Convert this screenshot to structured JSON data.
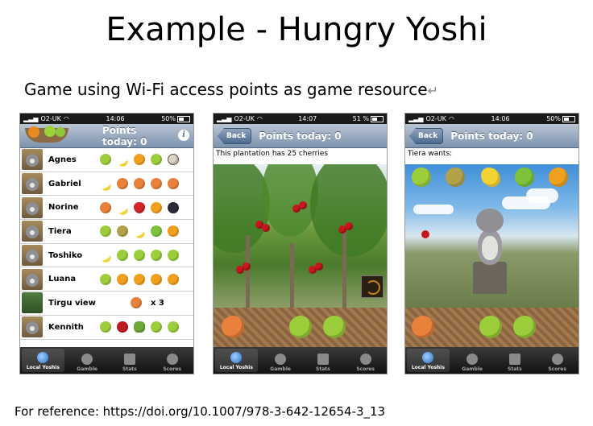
{
  "slide": {
    "title": "Example - Hungry Yoshi",
    "subtitle": "Game using Wi-Fi access points as game resource",
    "reference": "For reference: https://doi.org/10.1007/978-3-642-12654-3_13"
  },
  "screens": [
    {
      "status": {
        "carrier": "O2-UK",
        "time": "14:06",
        "battery": "50%"
      },
      "nav_title": "Points today: 0",
      "info_glyph": "i",
      "rows": [
        {
          "name": "Agnes",
          "fruits": [
            "lime",
            "banana",
            "orange",
            "lime",
            "coconut"
          ]
        },
        {
          "name": "Gabriel",
          "fruits": [
            "banana",
            "peach",
            "peach",
            "peach",
            "peach"
          ]
        },
        {
          "name": "Norine",
          "fruits": [
            "peach",
            "banana",
            "strawberry",
            "orange",
            "blackberry"
          ]
        },
        {
          "name": "Tiera",
          "fruits": [
            "lime",
            "kiwi",
            "banana",
            "apple",
            "orange"
          ]
        },
        {
          "name": "Toshiko",
          "fruits": [
            "banana",
            "lime",
            "lime",
            "lime",
            "lime"
          ]
        },
        {
          "name": "Luana",
          "fruits": [
            "lime",
            "orange",
            "orange",
            "orange",
            "orange"
          ]
        },
        {
          "name": "Tirgu view",
          "count": "x 3",
          "fruits": [
            "peach"
          ]
        },
        {
          "name": "Kennith",
          "fruits": [
            "lime",
            "cherry",
            "broccoli",
            "lime",
            "lime"
          ]
        }
      ]
    },
    {
      "status": {
        "carrier": "O2-UK",
        "time": "14:07",
        "battery": "51 %"
      },
      "back_label": "Back",
      "nav_title": "Points today: 0",
      "caption": "This plantation has 25 cherries"
    },
    {
      "status": {
        "carrier": "O2-UK",
        "time": "14:06",
        "battery": "50%"
      },
      "back_label": "Back",
      "nav_title": "Points today: 0",
      "caption": "Tiera wants:",
      "wants": [
        "lime",
        "kiwi",
        "banana",
        "apple",
        "orange"
      ]
    }
  ],
  "tabs": [
    "Local Yoshis",
    "Gamble",
    "Stats",
    "Scores"
  ],
  "icons": {
    "tab_icons": [
      "globe-icon",
      "fleur-de-lis-icon",
      "stats-icon",
      "scales-icon"
    ]
  }
}
